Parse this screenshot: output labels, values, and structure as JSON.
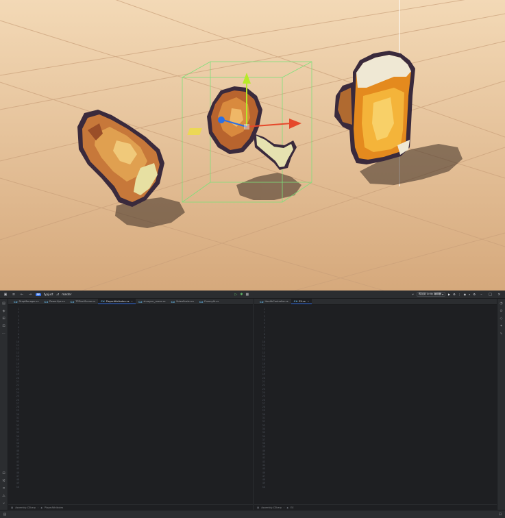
{
  "scene": {
    "background_top": "#f5dcbb",
    "background_bottom": "#d9ad80",
    "grid_color": "#c89f77",
    "selection_box_color": "#7ee07a",
    "gizmo_y_color": "#b7ea2a",
    "gizmo_x_color": "#e5482a",
    "gizmo_z_color": "#2a6fe5",
    "objects": [
      "bread",
      "chicken-leg",
      "beer-mug"
    ]
  },
  "ide": {
    "titlebar": {
      "project_badge": "FP",
      "project_name": "fypjuct",
      "branch": "master",
      "unity_label": "附加到 Unity 编辑器",
      "menu_icon": "hamburger-menu-icon"
    },
    "left_pane": {
      "tabs": [
        {
          "icon": "C#",
          "label": "DropManager.cs",
          "active": false
        },
        {
          "icon": "C#",
          "label": "PowerUps.cs",
          "active": false
        },
        {
          "icon": "C#",
          "label": "TPPiectScene.cs",
          "active": false
        },
        {
          "icon": "C#",
          "label": "PlayerAttributes.cs",
          "active": true
        },
        {
          "icon": "C#",
          "label": "zhaoyun_move.cs",
          "active": false
        },
        {
          "icon": "C#",
          "label": "VideoScaler.cs",
          "active": false
        },
        {
          "icon": "C#",
          "label": "EnemyAi.cs",
          "active": false
        }
      ],
      "status_assembly": "Assembly-CSharp",
      "status_class": "PlayerAttributes"
    },
    "right_pane": {
      "tabs": [
        {
          "icon": "C#",
          "label": "HealthController.cs",
          "active": false
        },
        {
          "icon": "C#",
          "label": "EX.cs",
          "active": true
        }
      ],
      "status_assembly": "Assembly-CSharp",
      "status_class": "EX"
    }
  }
}
